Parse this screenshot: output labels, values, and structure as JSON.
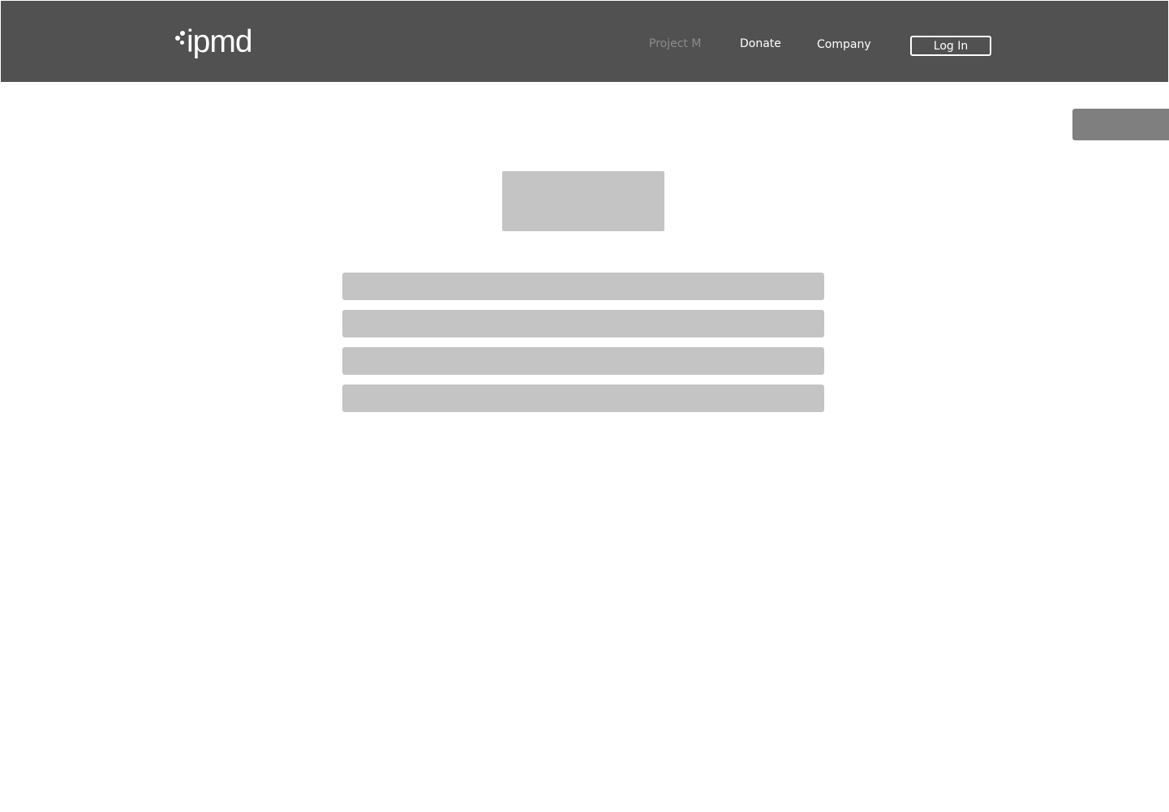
{
  "header": {
    "logo_text": "ipmd",
    "nav": {
      "project": "Project M",
      "donate": "Donate",
      "company": "Company"
    },
    "login_label": "Log In"
  },
  "colors": {
    "header_bg": "#515151",
    "placeholder": "#c4c4c4",
    "side_tab": "#7f7f7f",
    "muted_link": "#8c8c8c",
    "text_on_dark": "#ffffff"
  }
}
